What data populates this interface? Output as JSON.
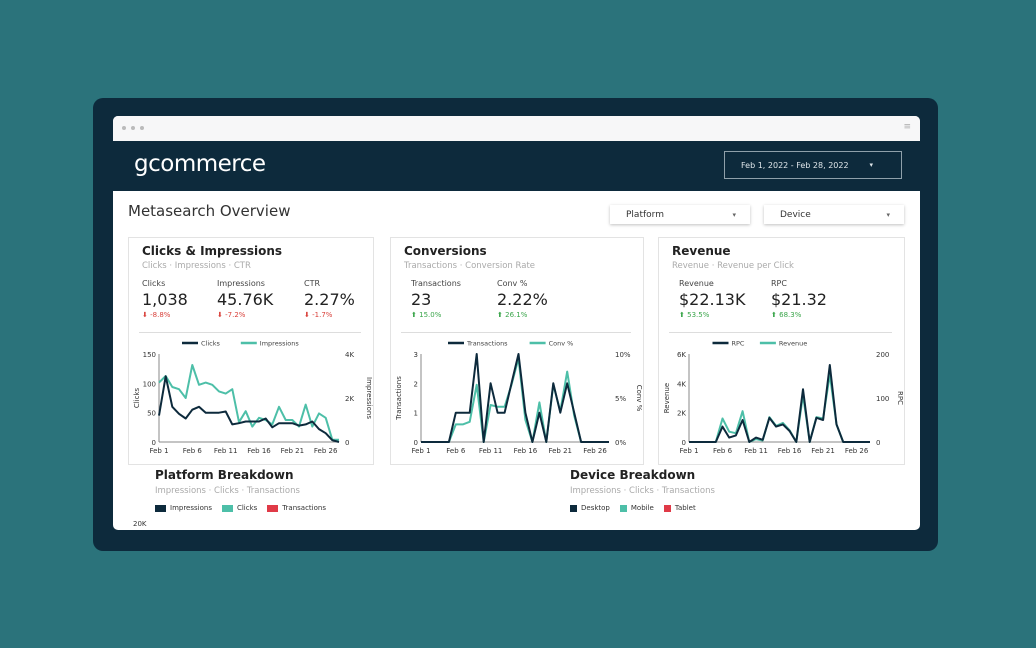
{
  "app": {
    "logo": "gcommerce",
    "date_range": "Feb 1, 2022 - Feb 28, 2022"
  },
  "page": {
    "title": "Metasearch Overview",
    "filters": [
      "Platform",
      "Device"
    ]
  },
  "colors": {
    "dark": "#0d2a3c",
    "teal": "#4dbfa8",
    "red": "#e03a47",
    "background": "#2b737b"
  },
  "cards": [
    {
      "title": "Clicks & Impressions",
      "subtitle": "Clicks · Impressions · CTR",
      "metrics": [
        {
          "label": "Clicks",
          "value": "1,038",
          "delta": "-8.8%",
          "dir": "down"
        },
        {
          "label": "Impressions",
          "value": "45.76K",
          "delta": "-7.2%",
          "dir": "down"
        },
        {
          "label": "CTR",
          "value": "2.27%",
          "delta": "-1.7%",
          "dir": "down"
        }
      ]
    },
    {
      "title": "Conversions",
      "subtitle": "Transactions · Conversion Rate",
      "metrics": [
        {
          "label": "Transactions",
          "value": "23",
          "delta": "15.0%",
          "dir": "up"
        },
        {
          "label": "Conv %",
          "value": "2.22%",
          "delta": "26.1%",
          "dir": "up"
        }
      ]
    },
    {
      "title": "Revenue",
      "subtitle": "Revenue · Revenue per Click",
      "metrics": [
        {
          "label": "Revenue",
          "value": "$22.13K",
          "delta": "53.5%",
          "dir": "up"
        },
        {
          "label": "RPC",
          "value": "$21.32",
          "delta": "68.3%",
          "dir": "up"
        }
      ]
    }
  ],
  "chart_data": [
    {
      "type": "line",
      "x_ticks": [
        "Feb 1",
        "Feb 6",
        "Feb 11",
        "Feb 16",
        "Feb 21",
        "Feb 26"
      ],
      "ylabel": "Clicks",
      "y2label": "Impressions",
      "y_ticks": [
        "0",
        "50",
        "100",
        "150"
      ],
      "y2_ticks": [
        "0",
        "2K",
        "4K"
      ],
      "ylim": [
        0,
        150
      ],
      "y2lim": [
        0,
        4000
      ],
      "series": [
        {
          "name": "Clicks",
          "axis": "left",
          "color": "#0d2a3c",
          "values": [
            45,
            112,
            60,
            48,
            40,
            55,
            60,
            50,
            50,
            50,
            52,
            30,
            32,
            35,
            35,
            35,
            40,
            25,
            32,
            32,
            32,
            28,
            30,
            35,
            22,
            15,
            3,
            0
          ]
        },
        {
          "name": "Impressions",
          "axis": "right",
          "color": "#4dbfa8",
          "values": [
            2700,
            3000,
            2500,
            2400,
            2000,
            3500,
            2600,
            2700,
            2600,
            2300,
            2200,
            2400,
            900,
            1400,
            700,
            1100,
            1000,
            800,
            1600,
            1000,
            1000,
            700,
            1700,
            700,
            1300,
            1100,
            100,
            100
          ]
        }
      ]
    },
    {
      "type": "line",
      "x_ticks": [
        "Feb 1",
        "Feb 6",
        "Feb 11",
        "Feb 16",
        "Feb 21",
        "Feb 26"
      ],
      "ylabel": "Transactions",
      "y2label": "Conv %",
      "y_ticks": [
        "0",
        "1",
        "2",
        "3"
      ],
      "y2_ticks": [
        "0%",
        "5%",
        "10%"
      ],
      "ylim": [
        0,
        3
      ],
      "y2lim": [
        0,
        10
      ],
      "series": [
        {
          "name": "Transactions",
          "axis": "left",
          "color": "#0d2a3c",
          "values": [
            0,
            0,
            0,
            0,
            0,
            1,
            1,
            1,
            3,
            0,
            2,
            1,
            1,
            2,
            3,
            1,
            0,
            1,
            0,
            2,
            1,
            2,
            1,
            0,
            0,
            0,
            0,
            0
          ]
        },
        {
          "name": "Conv %",
          "axis": "right",
          "color": "#4dbfa8",
          "values": [
            0,
            0,
            0,
            0,
            0,
            2,
            2,
            2.3,
            6.5,
            0,
            4.2,
            4,
            4,
            6.5,
            9.5,
            2.5,
            0,
            4.5,
            0,
            6.5,
            3.5,
            8,
            3,
            0,
            0,
            0,
            0,
            0
          ]
        }
      ]
    },
    {
      "type": "line",
      "x_ticks": [
        "Feb 1",
        "Feb 6",
        "Feb 11",
        "Feb 16",
        "Feb 21",
        "Feb 26"
      ],
      "ylabel": "Revenue",
      "y2label": "RPC",
      "y_ticks": [
        "0",
        "2K",
        "4K",
        "6K"
      ],
      "y2_ticks": [
        "0",
        "100",
        "200"
      ],
      "ylim": [
        0,
        6000
      ],
      "y2lim": [
        0,
        200
      ],
      "series": [
        {
          "name": "RPC",
          "axis": "right",
          "color": "#0d2a3c",
          "values": [
            0,
            0,
            0,
            0,
            0,
            35,
            10,
            15,
            50,
            0,
            10,
            5,
            55,
            35,
            40,
            25,
            0,
            120,
            0,
            55,
            50,
            175,
            40,
            0,
            0,
            0,
            0,
            0
          ]
        },
        {
          "name": "Revenue",
          "axis": "left",
          "color": "#4dbfa8",
          "values": [
            0,
            0,
            0,
            0,
            0,
            1600,
            700,
            600,
            2100,
            0,
            200,
            100,
            1700,
            1100,
            1300,
            800,
            0,
            3200,
            0,
            1700,
            1600,
            4600,
            1200,
            0,
            0,
            0,
            0,
            0
          ]
        }
      ]
    }
  ],
  "breakdowns": [
    {
      "title": "Platform Breakdown",
      "subtitle": "Impressions · Clicks · Transactions",
      "legend": [
        {
          "label": "Impressions",
          "color": "#0d2a3c"
        },
        {
          "label": "Clicks",
          "color": "#4dbfa8"
        },
        {
          "label": "Transactions",
          "color": "#e03a47"
        }
      ],
      "y_tick": "20K"
    },
    {
      "title": "Device Breakdown",
      "subtitle": "Impressions · Clicks · Transactions",
      "legend": [
        {
          "label": "Desktop",
          "color": "#0d2a3c"
        },
        {
          "label": "Mobile",
          "color": "#4dbfa8"
        },
        {
          "label": "Tablet",
          "color": "#e03a47"
        }
      ]
    }
  ]
}
